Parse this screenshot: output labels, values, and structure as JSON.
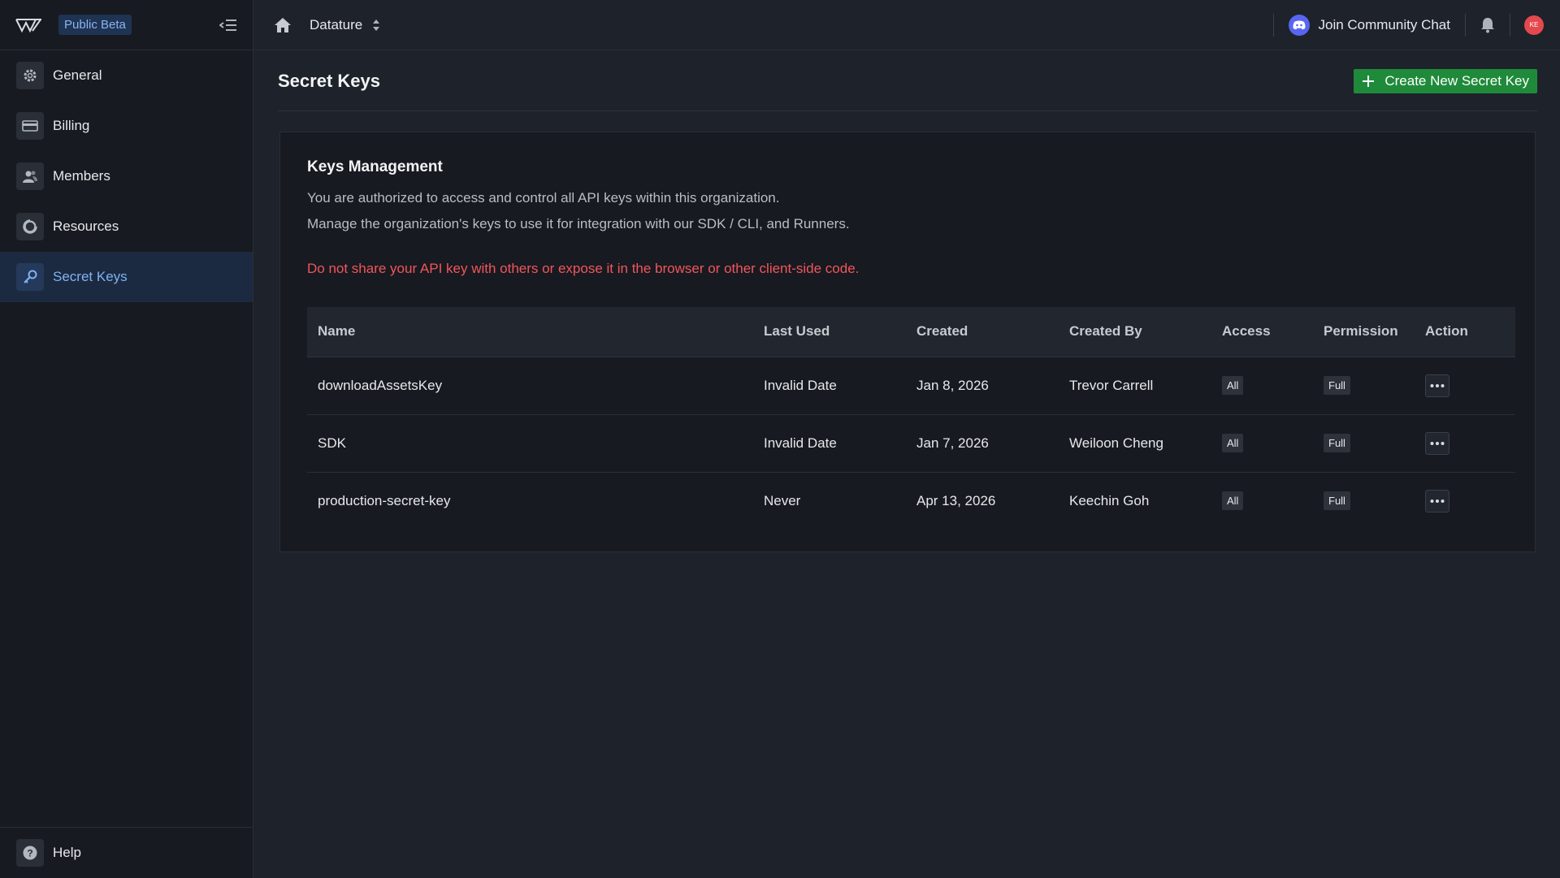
{
  "sidebar": {
    "beta_badge": "Public Beta",
    "items": [
      {
        "label": "General",
        "icon": "gear-icon"
      },
      {
        "label": "Billing",
        "icon": "credit-card-icon"
      },
      {
        "label": "Members",
        "icon": "users-icon"
      },
      {
        "label": "Resources",
        "icon": "pie-chart-icon"
      },
      {
        "label": "Secret Keys",
        "icon": "key-icon",
        "active": true
      }
    ],
    "help_label": "Help"
  },
  "topbar": {
    "org_name": "Datature",
    "community_label": "Join Community Chat",
    "avatar_initials": "KE"
  },
  "page": {
    "title": "Secret Keys",
    "create_button": "Create New Secret Key"
  },
  "card": {
    "title": "Keys Management",
    "desc1": "You are authorized to access and control all API keys within this organization.",
    "desc2": "Manage the organization's keys to use it for integration with our SDK / CLI, and Runners.",
    "warning": "Do not share your API key with others or expose it in the browser or other client-side code."
  },
  "table": {
    "headers": [
      "Name",
      "Last Used",
      "Created",
      "Created By",
      "Access",
      "Permission",
      "Action"
    ],
    "rows": [
      {
        "name": "downloadAssetsKey",
        "last_used": "Invalid Date",
        "created": "Jan 8, 2026",
        "created_by": "Trevor Carrell",
        "access": "All",
        "permission": "Full"
      },
      {
        "name": "SDK",
        "last_used": "Invalid Date",
        "created": "Jan 7, 2026",
        "created_by": "Weiloon Cheng",
        "access": "All",
        "permission": "Full"
      },
      {
        "name": "production-secret-key",
        "last_used": "Never",
        "created": "Apr 13, 2026",
        "created_by": "Keechin Goh",
        "access": "All",
        "permission": "Full"
      }
    ]
  },
  "colors": {
    "accent": "#1f8a3a",
    "warning": "#f0565c",
    "active_nav": "#7fb2f5",
    "avatar": "#e5484d"
  }
}
